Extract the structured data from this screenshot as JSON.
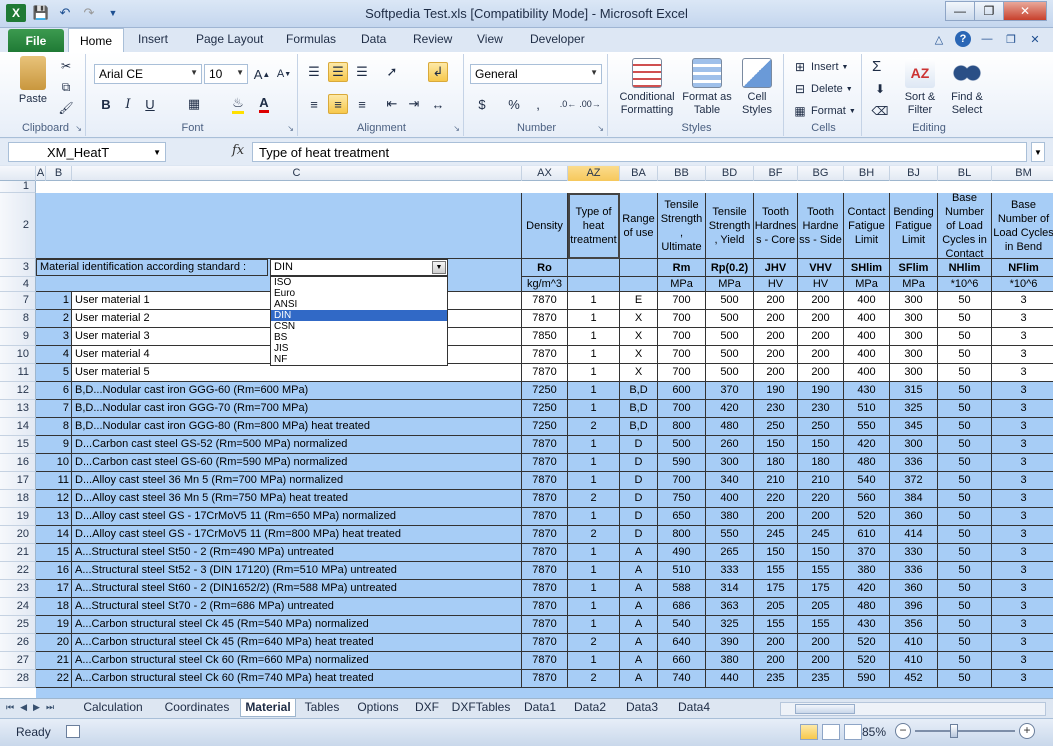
{
  "window": {
    "title": "Softpedia Test.xls  [Compatibility Mode]  -  Microsoft Excel",
    "app_icon": "X"
  },
  "ribbon_tabs": [
    "File",
    "Home",
    "Insert",
    "Page Layout",
    "Formulas",
    "Data",
    "Review",
    "View",
    "Developer"
  ],
  "ribbon": {
    "clipboard": {
      "label": "Clipboard",
      "paste": "Paste"
    },
    "font": {
      "label": "Font",
      "name": "Arial CE",
      "size": "10"
    },
    "alignment": {
      "label": "Alignment"
    },
    "number": {
      "label": "Number",
      "format": "General"
    },
    "styles": {
      "label": "Styles",
      "conditional": "Conditional Formatting",
      "format_table": "Format as Table",
      "cell_styles": "Cell Styles"
    },
    "cells": {
      "label": "Cells",
      "insert": "Insert",
      "delete": "Delete",
      "format": "Format"
    },
    "editing": {
      "label": "Editing",
      "sum": "Σ",
      "sort": "Sort & Filter",
      "find": "Find & Select"
    }
  },
  "formula_bar": {
    "name_box": "XM_HeatT",
    "fx": "fx",
    "formula": "Type of heat treatment"
  },
  "columns": [
    {
      "id": "A",
      "w": 10
    },
    {
      "id": "B",
      "w": 26
    },
    {
      "id": "C",
      "w": 450
    },
    {
      "id": "AX",
      "w": 46
    },
    {
      "id": "AZ",
      "w": 52
    },
    {
      "id": "BA",
      "w": 38
    },
    {
      "id": "BB",
      "w": 48
    },
    {
      "id": "BD",
      "w": 48
    },
    {
      "id": "BF",
      "w": 44
    },
    {
      "id": "BG",
      "w": 46
    },
    {
      "id": "BH",
      "w": 46
    },
    {
      "id": "BJ",
      "w": 48
    },
    {
      "id": "BL",
      "w": 54
    },
    {
      "id": "BM",
      "w": 64
    }
  ],
  "selected_column": "AZ",
  "row_numbers": [
    "1",
    "2",
    "3",
    "4",
    "7",
    "8",
    "9",
    "10",
    "11",
    "12",
    "13",
    "14",
    "15",
    "16",
    "17",
    "18",
    "19",
    "20",
    "21",
    "22",
    "23",
    "24",
    "25",
    "26",
    "27",
    "28"
  ],
  "header": {
    "r2": [
      "Density",
      "Type of heat treatment",
      "Range of use",
      "Tensile Strength , Ultimate",
      "Tensile Strength , Yield",
      "Tooth Hardnes s - Core",
      "Tooth Hardne ss - Side",
      "Contact Fatigue Limit",
      "Bending Fatigue Limit",
      "Base Number of Load Cycles in Contact",
      "Base Number of Load Cycles in Bend"
    ],
    "r3": [
      "Ro",
      "",
      "",
      "Rm",
      "Rp(0.2)",
      "JHV",
      "VHV",
      "SHlim",
      "SFlim",
      "NHlim",
      "NFlim"
    ],
    "r4": [
      "kg/m^3",
      "",
      "",
      "MPa",
      "MPa",
      "HV",
      "HV",
      "MPa",
      "MPa",
      "*10^6",
      "*10^6"
    ]
  },
  "material_standard": {
    "label": "Material identification according standard :",
    "value": "DIN",
    "options": [
      "ISO",
      "Euro",
      "ANSI",
      "DIN",
      "CSN",
      "BS",
      "JIS",
      "NF"
    ],
    "selected_index": 3
  },
  "rows": [
    {
      "n": "1",
      "name": "User material 1",
      "d": "7870",
      "t": "1",
      "r": "E",
      "rm": "700",
      "rp": "500",
      "jhv": "200",
      "vhv": "200",
      "sh": "400",
      "sf": "300",
      "nh": "50",
      "nf": "3",
      "user": true
    },
    {
      "n": "2",
      "name": "User material 2",
      "d": "7870",
      "t": "1",
      "r": "X",
      "rm": "700",
      "rp": "500",
      "jhv": "200",
      "vhv": "200",
      "sh": "400",
      "sf": "300",
      "nh": "50",
      "nf": "3",
      "user": true
    },
    {
      "n": "3",
      "name": "User material 3",
      "d": "7850",
      "t": "1",
      "r": "X",
      "rm": "700",
      "rp": "500",
      "jhv": "200",
      "vhv": "200",
      "sh": "400",
      "sf": "300",
      "nh": "50",
      "nf": "3",
      "user": true
    },
    {
      "n": "4",
      "name": "User material 4",
      "d": "7870",
      "t": "1",
      "r": "X",
      "rm": "700",
      "rp": "500",
      "jhv": "200",
      "vhv": "200",
      "sh": "400",
      "sf": "300",
      "nh": "50",
      "nf": "3",
      "user": true
    },
    {
      "n": "5",
      "name": "User material 5",
      "d": "7870",
      "t": "1",
      "r": "X",
      "rm": "700",
      "rp": "500",
      "jhv": "200",
      "vhv": "200",
      "sh": "400",
      "sf": "300",
      "nh": "50",
      "nf": "3",
      "user": true
    },
    {
      "n": "6",
      "name": "B,D...Nodular cast iron GGG-60 (Rm=600 MPa)",
      "d": "7250",
      "t": "1",
      "r": "B,D",
      "rm": "600",
      "rp": "370",
      "jhv": "190",
      "vhv": "190",
      "sh": "430",
      "sf": "315",
      "nh": "50",
      "nf": "3"
    },
    {
      "n": "7",
      "name": "B,D...Nodular cast iron GGG-70 (Rm=700 MPa)",
      "d": "7250",
      "t": "1",
      "r": "B,D",
      "rm": "700",
      "rp": "420",
      "jhv": "230",
      "vhv": "230",
      "sh": "510",
      "sf": "325",
      "nh": "50",
      "nf": "3"
    },
    {
      "n": "8",
      "name": "B,D...Nodular cast iron GGG-80 (Rm=800 MPa) heat treated",
      "d": "7250",
      "t": "2",
      "r": "B,D",
      "rm": "800",
      "rp": "480",
      "jhv": "250",
      "vhv": "250",
      "sh": "550",
      "sf": "345",
      "nh": "50",
      "nf": "3"
    },
    {
      "n": "9",
      "name": "D...Carbon cast steel GS-52 (Rm=500 MPa) normalized",
      "d": "7870",
      "t": "1",
      "r": "D",
      "rm": "500",
      "rp": "260",
      "jhv": "150",
      "vhv": "150",
      "sh": "420",
      "sf": "300",
      "nh": "50",
      "nf": "3"
    },
    {
      "n": "10",
      "name": "D...Carbon cast steel GS-60 (Rm=590 MPa) normalized",
      "d": "7870",
      "t": "1",
      "r": "D",
      "rm": "590",
      "rp": "300",
      "jhv": "180",
      "vhv": "180",
      "sh": "480",
      "sf": "336",
      "nh": "50",
      "nf": "3"
    },
    {
      "n": "11",
      "name": "D...Alloy cast steel 36 Mn 5 (Rm=700 MPa) normalized",
      "d": "7870",
      "t": "1",
      "r": "D",
      "rm": "700",
      "rp": "340",
      "jhv": "210",
      "vhv": "210",
      "sh": "540",
      "sf": "372",
      "nh": "50",
      "nf": "3"
    },
    {
      "n": "12",
      "name": "D...Alloy cast steel 36 Mn 5 (Rm=750 MPa) heat treated",
      "d": "7870",
      "t": "2",
      "r": "D",
      "rm": "750",
      "rp": "400",
      "jhv": "220",
      "vhv": "220",
      "sh": "560",
      "sf": "384",
      "nh": "50",
      "nf": "3"
    },
    {
      "n": "13",
      "name": "D...Alloy cast steel GS - 17CrMoV5 11 (Rm=650 MPa) normalized",
      "d": "7870",
      "t": "1",
      "r": "D",
      "rm": "650",
      "rp": "380",
      "jhv": "200",
      "vhv": "200",
      "sh": "520",
      "sf": "360",
      "nh": "50",
      "nf": "3"
    },
    {
      "n": "14",
      "name": "D...Alloy cast steel GS - 17CrMoV5 11 (Rm=800 MPa) heat treated",
      "d": "7870",
      "t": "2",
      "r": "D",
      "rm": "800",
      "rp": "550",
      "jhv": "245",
      "vhv": "245",
      "sh": "610",
      "sf": "414",
      "nh": "50",
      "nf": "3"
    },
    {
      "n": "15",
      "name": "A...Structural steel St50 - 2 (Rm=490 MPa) untreated",
      "d": "7870",
      "t": "1",
      "r": "A",
      "rm": "490",
      "rp": "265",
      "jhv": "150",
      "vhv": "150",
      "sh": "370",
      "sf": "330",
      "nh": "50",
      "nf": "3"
    },
    {
      "n": "16",
      "name": "A...Structural steel St52 - 3 (DIN 17120) (Rm=510 MPa) untreated",
      "d": "7870",
      "t": "1",
      "r": "A",
      "rm": "510",
      "rp": "333",
      "jhv": "155",
      "vhv": "155",
      "sh": "380",
      "sf": "336",
      "nh": "50",
      "nf": "3"
    },
    {
      "n": "17",
      "name": "A...Structural steel St60 - 2 (DIN1652/2) (Rm=588 MPa) untreated",
      "d": "7870",
      "t": "1",
      "r": "A",
      "rm": "588",
      "rp": "314",
      "jhv": "175",
      "vhv": "175",
      "sh": "420",
      "sf": "360",
      "nh": "50",
      "nf": "3"
    },
    {
      "n": "18",
      "name": "A...Structural steel St70 - 2 (Rm=686 MPa) untreated",
      "d": "7870",
      "t": "1",
      "r": "A",
      "rm": "686",
      "rp": "363",
      "jhv": "205",
      "vhv": "205",
      "sh": "480",
      "sf": "396",
      "nh": "50",
      "nf": "3"
    },
    {
      "n": "19",
      "name": "A...Carbon structural steel Ck 45 (Rm=540 MPa) normalized",
      "d": "7870",
      "t": "1",
      "r": "A",
      "rm": "540",
      "rp": "325",
      "jhv": "155",
      "vhv": "155",
      "sh": "430",
      "sf": "356",
      "nh": "50",
      "nf": "3"
    },
    {
      "n": "20",
      "name": "A...Carbon structural steel Ck 45 (Rm=640 MPa) heat treated",
      "d": "7870",
      "t": "2",
      "r": "A",
      "rm": "640",
      "rp": "390",
      "jhv": "200",
      "vhv": "200",
      "sh": "520",
      "sf": "410",
      "nh": "50",
      "nf": "3"
    },
    {
      "n": "21",
      "name": "A...Carbon structural steel Ck 60 (Rm=660 MPa) normalized",
      "d": "7870",
      "t": "1",
      "r": "A",
      "rm": "660",
      "rp": "380",
      "jhv": "200",
      "vhv": "200",
      "sh": "520",
      "sf": "410",
      "nh": "50",
      "nf": "3"
    },
    {
      "n": "22",
      "name": "A...Carbon structural steel Ck 60 (Rm=740 MPa) heat treated",
      "d": "7870",
      "t": "2",
      "r": "A",
      "rm": "740",
      "rp": "440",
      "jhv": "235",
      "vhv": "235",
      "sh": "590",
      "sf": "452",
      "nh": "50",
      "nf": "3"
    }
  ],
  "sheet_tabs": [
    "Calculation",
    "Coordinates",
    "Material",
    "Tables",
    "Options",
    "DXF",
    "DXFTables",
    "Data1",
    "Data2",
    "Data3",
    "Data4"
  ],
  "active_sheet": "Material",
  "status": {
    "ready": "Ready",
    "zoom": "85%"
  },
  "colors": {
    "grid_fill": "#a7cdf6",
    "accent": "#1f7a35",
    "selection": "#3169c6"
  }
}
